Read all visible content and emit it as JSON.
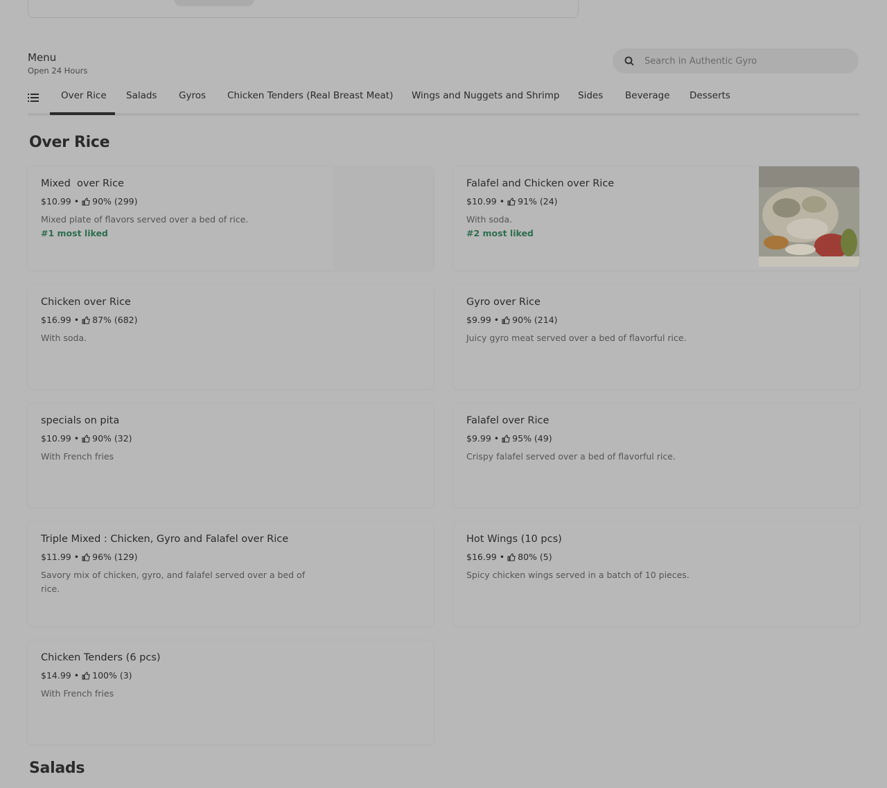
{
  "menu": {
    "title": "Menu",
    "hours": "Open 24 Hours"
  },
  "search": {
    "placeholder": "Search in Authentic Gyro"
  },
  "tabs": [
    {
      "label": "Over Rice",
      "active": true
    },
    {
      "label": "Salads"
    },
    {
      "label": "Gyros"
    },
    {
      "label": "Chicken Tenders (Real Breast Meat)"
    },
    {
      "label": "Wings and Nuggets and Shrimp"
    },
    {
      "label": "Sides"
    },
    {
      "label": "Beverage"
    },
    {
      "label": "Desserts"
    }
  ],
  "sections": {
    "over_rice": "Over Rice",
    "salads": "Salads"
  },
  "items": [
    {
      "name": "Mixed  over Rice",
      "price": "$10.99",
      "rating": "90% (299)",
      "desc": "Mixed plate of flavors served over a bed of rice.",
      "badge": "#1 most liked"
    },
    {
      "name": "Falafel and Chicken over Rice",
      "price": "$10.99",
      "rating": "91% (24)",
      "desc": "With soda.",
      "badge": "#2 most liked"
    },
    {
      "name": "Chicken over Rice",
      "price": "$16.99",
      "rating": "87% (682)",
      "desc": "With soda."
    },
    {
      "name": "Gyro over Rice",
      "price": "$9.99",
      "rating": "90% (214)",
      "desc": "Juicy gyro meat served over a bed of flavorful rice."
    },
    {
      "name": "specials on pita",
      "price": "$10.99",
      "rating": "90% (32)",
      "desc": "With French fries"
    },
    {
      "name": "Falafel over Rice",
      "price": "$9.99",
      "rating": "95% (49)",
      "desc": "Crispy falafel served over a bed of flavorful rice."
    },
    {
      "name": "Triple Mixed : Chicken, Gyro and Falafel over Rice",
      "price": "$11.99",
      "rating": "96% (129)",
      "desc": "Savory mix of chicken, gyro, and falafel served over a bed of rice."
    },
    {
      "name": "Hot Wings (10 pcs)",
      "price": "$16.99",
      "rating": "80% (5)",
      "desc": "Spicy chicken wings served in a batch of 10 pieces."
    },
    {
      "name": "Chicken Tenders (6 pcs)",
      "price": "$14.99",
      "rating": "100% (3)",
      "desc": "With French fries"
    }
  ],
  "colors": {
    "overlay_bg": "#b8b8b8",
    "badge": "#2f6e4f",
    "text": "#2b2b2b"
  },
  "icons": {
    "search": "search-icon",
    "list": "list-icon",
    "thumbs_up": "thumbs-up-icon"
  }
}
